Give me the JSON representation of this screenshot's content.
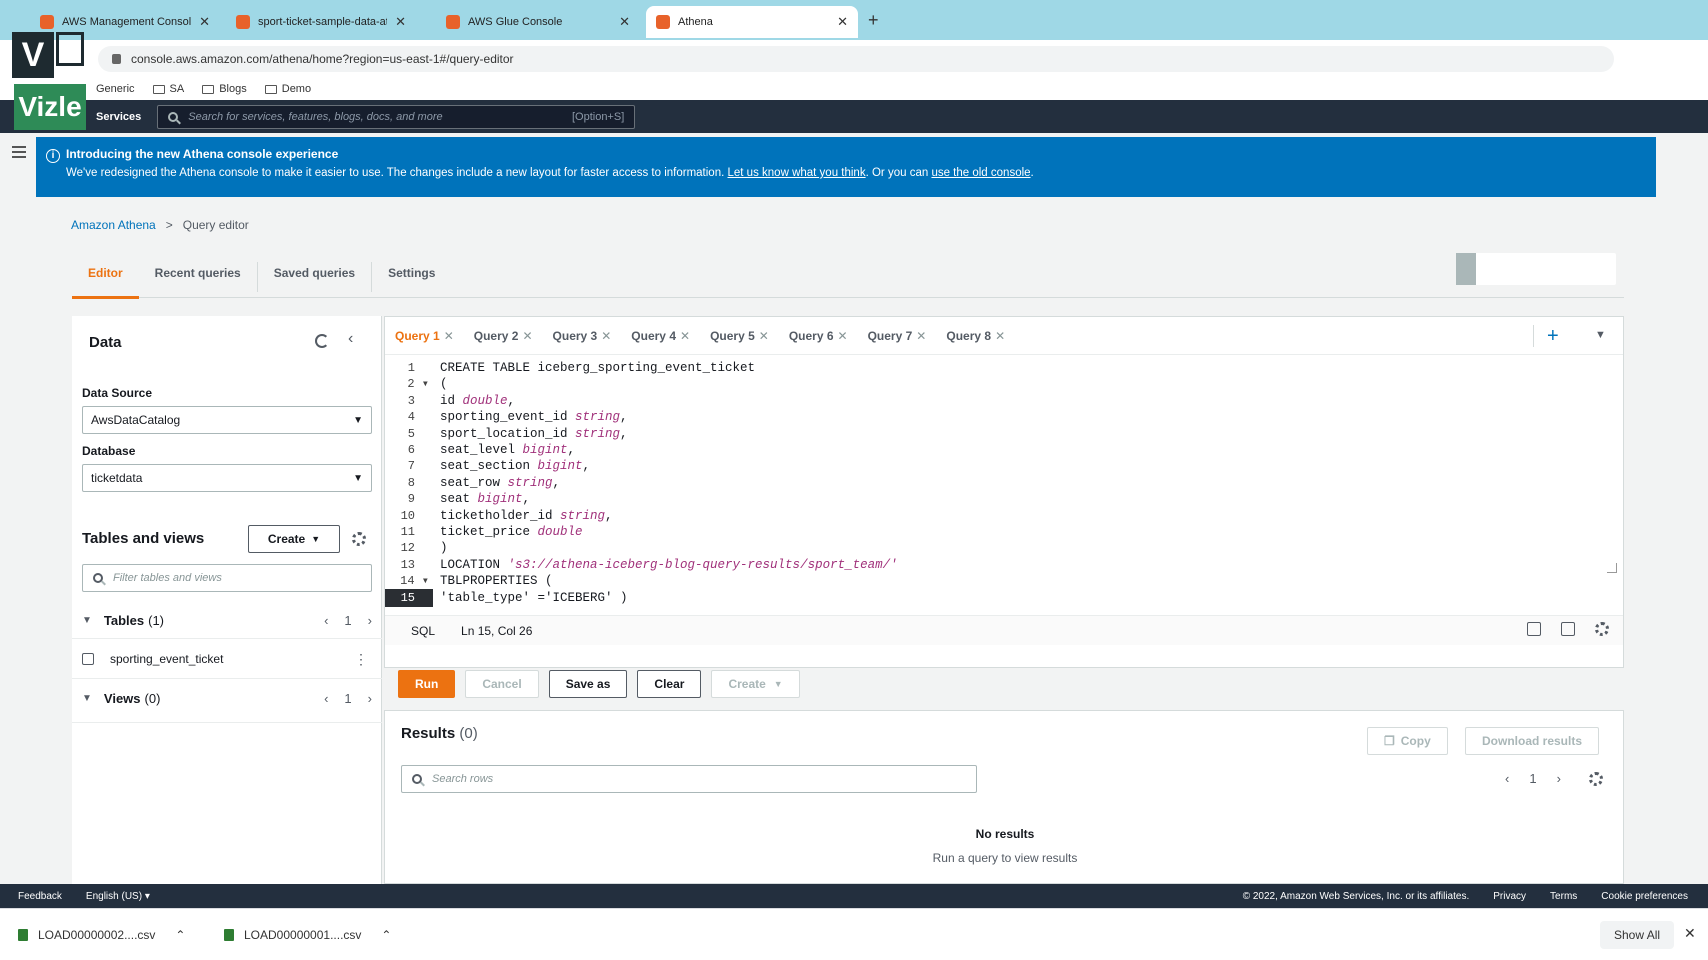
{
  "browser": {
    "tabs": [
      {
        "label": "AWS Management Console",
        "active": false
      },
      {
        "label": "sport-ticket-sample-data-athena",
        "active": false
      },
      {
        "label": "AWS Glue Console",
        "active": false
      },
      {
        "label": "Athena",
        "active": true
      }
    ],
    "new_tab": "+",
    "url": "console.aws.amazon.com/athena/home?region=us-east-1#/query-editor",
    "bookmarks": [
      "Generic",
      "SA",
      "Blogs",
      "Demo"
    ]
  },
  "logo": {
    "top": "V",
    "bottom": "Vizle"
  },
  "aws_nav": {
    "services": "Services",
    "search_placeholder": "Search for services, features, blogs, docs, and more",
    "search_shortcut": "[Option+S]"
  },
  "banner": {
    "title": "Introducing the new Athena console experience",
    "body": "We've redesigned the Athena console to make it easier to use. The changes include a new layout for faster access to information.",
    "link1": "Let us know what you think",
    "middle": ". Or you can",
    "link2": "use the old console",
    "end": "."
  },
  "breadcrumb": {
    "root": "Amazon Athena",
    "sep": ">",
    "current": "Query editor"
  },
  "page_tabs": [
    "Editor",
    "Recent queries",
    "Saved queries",
    "Settings"
  ],
  "data_panel": {
    "title": "Data",
    "data_source_label": "Data Source",
    "data_source_value": "AwsDataCatalog",
    "database_label": "Database",
    "database_value": "ticketdata",
    "tables_views_title": "Tables and views",
    "create_label": "Create",
    "filter_placeholder": "Filter tables and views",
    "tables_label": "Tables",
    "tables_count": "(1)",
    "tables_page": "1",
    "table_items": [
      "sporting_event_ticket"
    ],
    "views_label": "Views",
    "views_count": "(0)",
    "views_page": "1"
  },
  "query_tabs": [
    "Query 1",
    "Query 2",
    "Query 3",
    "Query 4",
    "Query 5",
    "Query 6",
    "Query 7",
    "Query 8"
  ],
  "editor": {
    "lines": [
      {
        "n": "1",
        "parts": [
          {
            "t": "CREATE TABLE iceberg_sporting_event_ticket",
            "c": "kw"
          }
        ]
      },
      {
        "n": "2",
        "fold": true,
        "parts": [
          {
            "t": "(",
            "c": "kw"
          }
        ]
      },
      {
        "n": "3",
        "parts": [
          {
            "t": "id ",
            "c": "kw"
          },
          {
            "t": "double",
            "c": "typ"
          },
          {
            "t": ",",
            "c": "kw"
          }
        ]
      },
      {
        "n": "4",
        "parts": [
          {
            "t": "sporting_event_id ",
            "c": "kw"
          },
          {
            "t": "string",
            "c": "typ"
          },
          {
            "t": ",",
            "c": "kw"
          }
        ]
      },
      {
        "n": "5",
        "parts": [
          {
            "t": "sport_location_id ",
            "c": "kw"
          },
          {
            "t": "string",
            "c": "typ"
          },
          {
            "t": ",",
            "c": "kw"
          }
        ]
      },
      {
        "n": "6",
        "parts": [
          {
            "t": "seat_level ",
            "c": "kw"
          },
          {
            "t": "bigint",
            "c": "typ"
          },
          {
            "t": ",",
            "c": "kw"
          }
        ]
      },
      {
        "n": "7",
        "parts": [
          {
            "t": "seat_section ",
            "c": "kw"
          },
          {
            "t": "bigint",
            "c": "typ"
          },
          {
            "t": ",",
            "c": "kw"
          }
        ]
      },
      {
        "n": "8",
        "parts": [
          {
            "t": "seat_row ",
            "c": "kw"
          },
          {
            "t": "string",
            "c": "typ"
          },
          {
            "t": ",",
            "c": "kw"
          }
        ]
      },
      {
        "n": "9",
        "parts": [
          {
            "t": "seat ",
            "c": "kw"
          },
          {
            "t": "bigint",
            "c": "typ"
          },
          {
            "t": ",",
            "c": "kw"
          }
        ]
      },
      {
        "n": "10",
        "parts": [
          {
            "t": "ticketholder_id ",
            "c": "kw"
          },
          {
            "t": "string",
            "c": "typ"
          },
          {
            "t": ",",
            "c": "kw"
          }
        ]
      },
      {
        "n": "11",
        "parts": [
          {
            "t": "ticket_price ",
            "c": "kw"
          },
          {
            "t": "double",
            "c": "typ"
          }
        ]
      },
      {
        "n": "12",
        "parts": [
          {
            "t": ")",
            "c": "kw"
          }
        ]
      },
      {
        "n": "13",
        "parts": [
          {
            "t": "LOCATION ",
            "c": "kw"
          },
          {
            "t": "'s3://athena-iceberg-blog-query-results/sport_team/'",
            "c": "typ"
          }
        ]
      },
      {
        "n": "14",
        "fold": true,
        "parts": [
          {
            "t": "TBLPROPERTIES (",
            "c": "kw"
          }
        ]
      },
      {
        "n": "15",
        "current": true,
        "parts": [
          {
            "t": "'table_type' ='ICEBERG' )",
            "c": "kw"
          }
        ]
      }
    ],
    "status_lang": "SQL",
    "status_pos": "Ln 15, Col 26"
  },
  "actions": {
    "run": "Run",
    "cancel": "Cancel",
    "save_as": "Save as",
    "clear": "Clear",
    "create": "Create"
  },
  "results": {
    "title": "Results",
    "count": "(0)",
    "copy": "Copy",
    "download": "Download results",
    "search_placeholder": "Search rows",
    "page": "1",
    "empty_title": "No results",
    "empty_sub": "Run a query to view results"
  },
  "footer": {
    "feedback": "Feedback",
    "language": "English (US) ▾",
    "copyright": "© 2022, Amazon Web Services, Inc. or its affiliates.",
    "privacy": "Privacy",
    "terms": "Terms",
    "cookies": "Cookie preferences"
  },
  "downloads": {
    "items": [
      "LOAD00000002....csv",
      "LOAD00000001....csv"
    ],
    "show_all": "Show All"
  },
  "colors": {
    "accent": "#ec7211",
    "link": "#0073bb",
    "nav": "#232f3e",
    "banner": "#0073bb"
  }
}
